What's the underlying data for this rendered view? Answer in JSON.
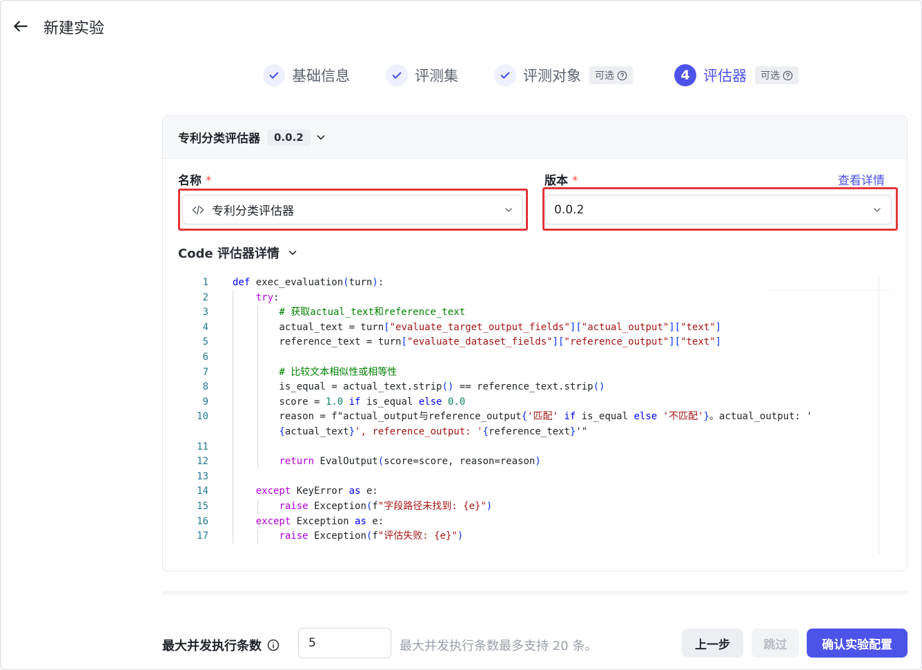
{
  "header": {
    "title": "新建实验"
  },
  "steps": [
    {
      "label": "基础信息",
      "status": "done"
    },
    {
      "label": "评测集",
      "status": "done"
    },
    {
      "label": "评测对象",
      "status": "done",
      "badge": "可选"
    },
    {
      "label": "评估器",
      "status": "active",
      "number": "4",
      "badge": "可选"
    }
  ],
  "evaluator_card": {
    "title": "专利分类评估器",
    "version_tag": "0.0.2",
    "name_field": {
      "label": "名称",
      "required_mark": "*",
      "value": "专利分类评估器"
    },
    "version_field": {
      "label": "版本",
      "required_mark": "*",
      "value": "0.0.2",
      "link": "查看详情"
    },
    "code_section_title": "Code 评估器详情"
  },
  "code": {
    "lines": [
      {
        "n": "1",
        "text": "def exec_evaluation(turn):"
      },
      {
        "n": "2",
        "text": "    try:"
      },
      {
        "n": "3",
        "text": "        # 获取actual_text和reference_text"
      },
      {
        "n": "4",
        "text": "        actual_text = turn[\"evaluate_target_output_fields\"][\"actual_output\"][\"text\"]"
      },
      {
        "n": "5",
        "text": "        reference_text = turn[\"evaluate_dataset_fields\"][\"reference_output\"][\"text\"]"
      },
      {
        "n": "6",
        "text": ""
      },
      {
        "n": "7",
        "text": "        # 比较文本相似性或相等性"
      },
      {
        "n": "8",
        "text": "        is_equal = actual_text.strip() == reference_text.strip()"
      },
      {
        "n": "9",
        "text": "        score = 1.0 if is_equal else 0.0"
      },
      {
        "n": "10",
        "text": "        reason = f\"actual_output与reference_output{'匹配' if is_equal else '不匹配'}。actual_output: '"
      },
      {
        "n": "",
        "text": "        {actual_text}', reference_output: '{reference_text}'\""
      },
      {
        "n": "11",
        "text": ""
      },
      {
        "n": "12",
        "text": "        return EvalOutput(score=score, reason=reason)"
      },
      {
        "n": "13",
        "text": ""
      },
      {
        "n": "14",
        "text": "    except KeyError as e:"
      },
      {
        "n": "15",
        "text": "        raise Exception(f\"字段路径未找到: {e}\")"
      },
      {
        "n": "16",
        "text": "    except Exception as e:"
      },
      {
        "n": "17",
        "text": "        raise Exception(f\"评估失败: {e}\")"
      }
    ]
  },
  "footer": {
    "concurrency_label": "最大并发执行条数",
    "concurrency_value": "5",
    "hint": "最大并发执行条数最多支持 20 条。",
    "prev_label": "上一步",
    "skip_label": "跳过",
    "confirm_label": "确认实验配置"
  },
  "colors": {
    "accent": "#4d53e8",
    "highlight": "#e0353b",
    "required": "#f54a45"
  }
}
